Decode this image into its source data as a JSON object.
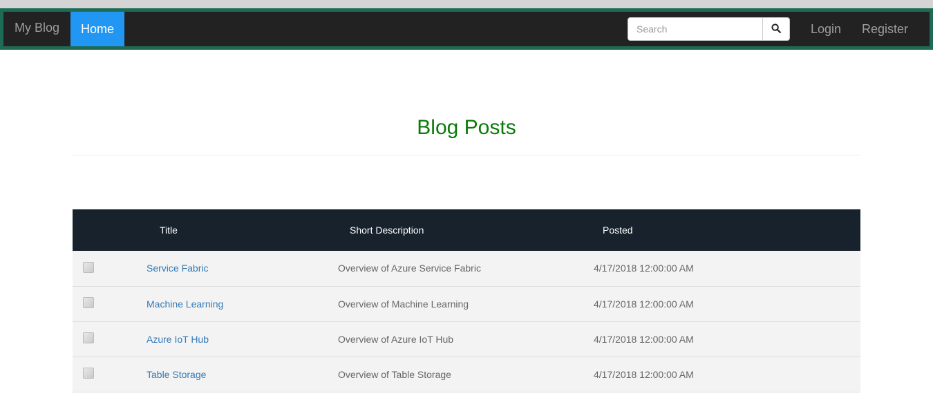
{
  "navbar": {
    "brand": "My Blog",
    "home_label": "Home",
    "search_placeholder": "Search",
    "login_label": "Login",
    "register_label": "Register"
  },
  "page": {
    "title": "Blog Posts"
  },
  "table": {
    "headers": {
      "title": "Title",
      "description": "Short Description",
      "posted": "Posted"
    },
    "rows": [
      {
        "title": "Service Fabric",
        "description": "Overview of Azure Service Fabric",
        "posted": "4/17/2018 12:00:00 AM"
      },
      {
        "title": "Machine Learning",
        "description": "Overview of Machine Learning",
        "posted": "4/17/2018 12:00:00 AM"
      },
      {
        "title": "Azure IoT Hub",
        "description": "Overview of Azure IoT Hub",
        "posted": "4/17/2018 12:00:00 AM"
      },
      {
        "title": "Table Storage",
        "description": "Overview of Table Storage",
        "posted": "4/17/2018 12:00:00 AM"
      }
    ]
  },
  "icons": {
    "search": "search-icon",
    "thumbnail": "broken-image-icon"
  },
  "colors": {
    "nav_bg": "#222222",
    "nav_border": "#1d6b55",
    "active_tab": "#2196f3",
    "title": "#0a7b0a",
    "table_header": "#17222d",
    "link": "#337ab7"
  }
}
